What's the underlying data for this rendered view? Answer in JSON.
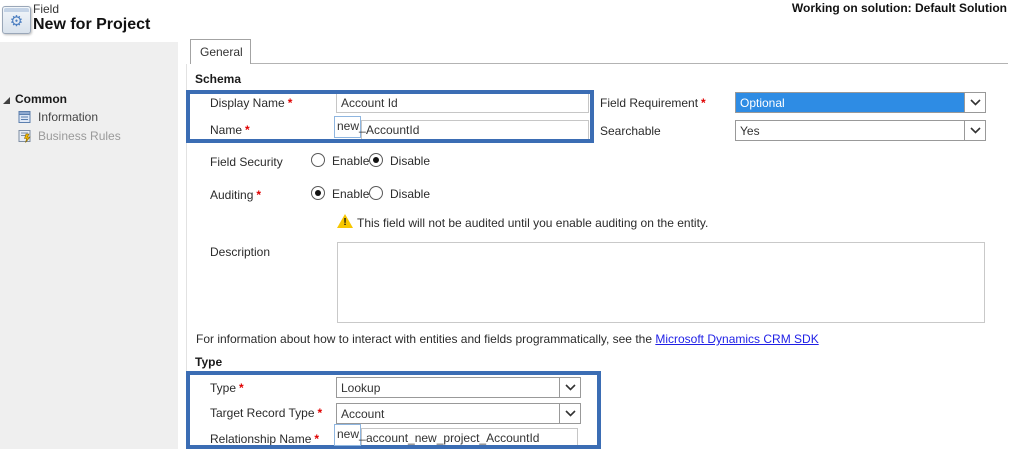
{
  "header": {
    "entity_type": "Field",
    "title": "New for Project",
    "working_on": "Working on solution: Default Solution"
  },
  "sidebar": {
    "group_label": "Common",
    "items": [
      {
        "label": "Information",
        "icon": "information-icon"
      },
      {
        "label": "Business Rules",
        "icon": "business-rules-icon"
      }
    ]
  },
  "tabs": {
    "general": "General"
  },
  "sections": {
    "schema": "Schema",
    "type": "Type"
  },
  "ui": {
    "required_marker": "*"
  },
  "fields": {
    "display_name": {
      "label": "Display Name",
      "value": "Account Id"
    },
    "name": {
      "label": "Name",
      "prefix": "new_",
      "value": "AccountId"
    },
    "field_requirement": {
      "label": "Field Requirement",
      "value": "Optional",
      "state": "focused-selection"
    },
    "searchable": {
      "label": "Searchable",
      "value": "Yes"
    },
    "field_security": {
      "label": "Field Security",
      "options": [
        "Enable",
        "Disable"
      ],
      "selected": "Disable"
    },
    "auditing": {
      "label": "Auditing",
      "options": [
        "Enable",
        "Disable"
      ],
      "selected": "Enable"
    },
    "audit_warning": "This field will not be audited until you enable auditing on the entity.",
    "description": {
      "label": "Description",
      "value": ""
    },
    "sdk_info": {
      "text": "For information about how to interact with entities and fields programmatically, see the ",
      "link": "Microsoft Dynamics CRM SDK"
    },
    "type": {
      "label": "Type",
      "value": "Lookup"
    },
    "target_record_type": {
      "label": "Target Record Type",
      "value": "Account"
    },
    "relationship_name": {
      "label": "Relationship Name",
      "prefix": "new_",
      "value": "account_new_project_AccountId"
    }
  },
  "colors": {
    "highlight_box": "#3b6db4",
    "selection_blue": "#2e8ce4",
    "link_blue": "#1f1fe6",
    "required_red": "#e00000",
    "sidebar_bg": "#efefef"
  }
}
